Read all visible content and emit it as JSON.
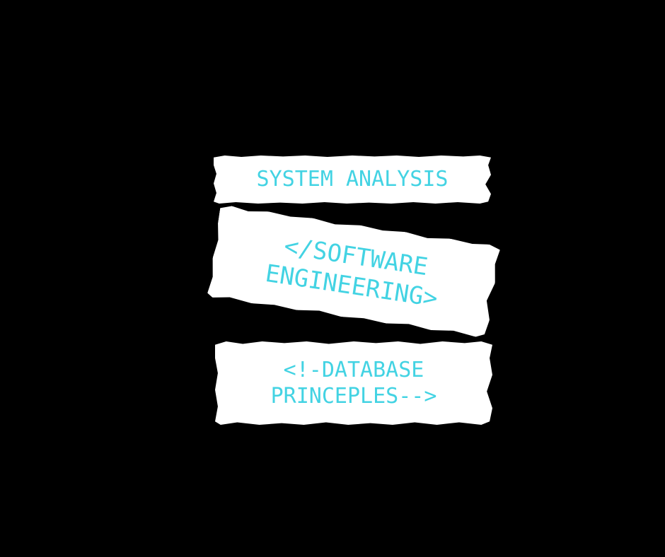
{
  "labels": {
    "system_analysis": "SYSTEM ANALYSIS",
    "software_engineering": {
      "line1": "</SOFTWARE",
      "line2": "ENGINEERING>"
    },
    "database_principles": {
      "line1": "<!-DATABASE",
      "line2": "PRINCEPLES-->"
    }
  },
  "colors": {
    "background": "#000000",
    "strip": "#ffffff",
    "text": "#43d3e3"
  }
}
